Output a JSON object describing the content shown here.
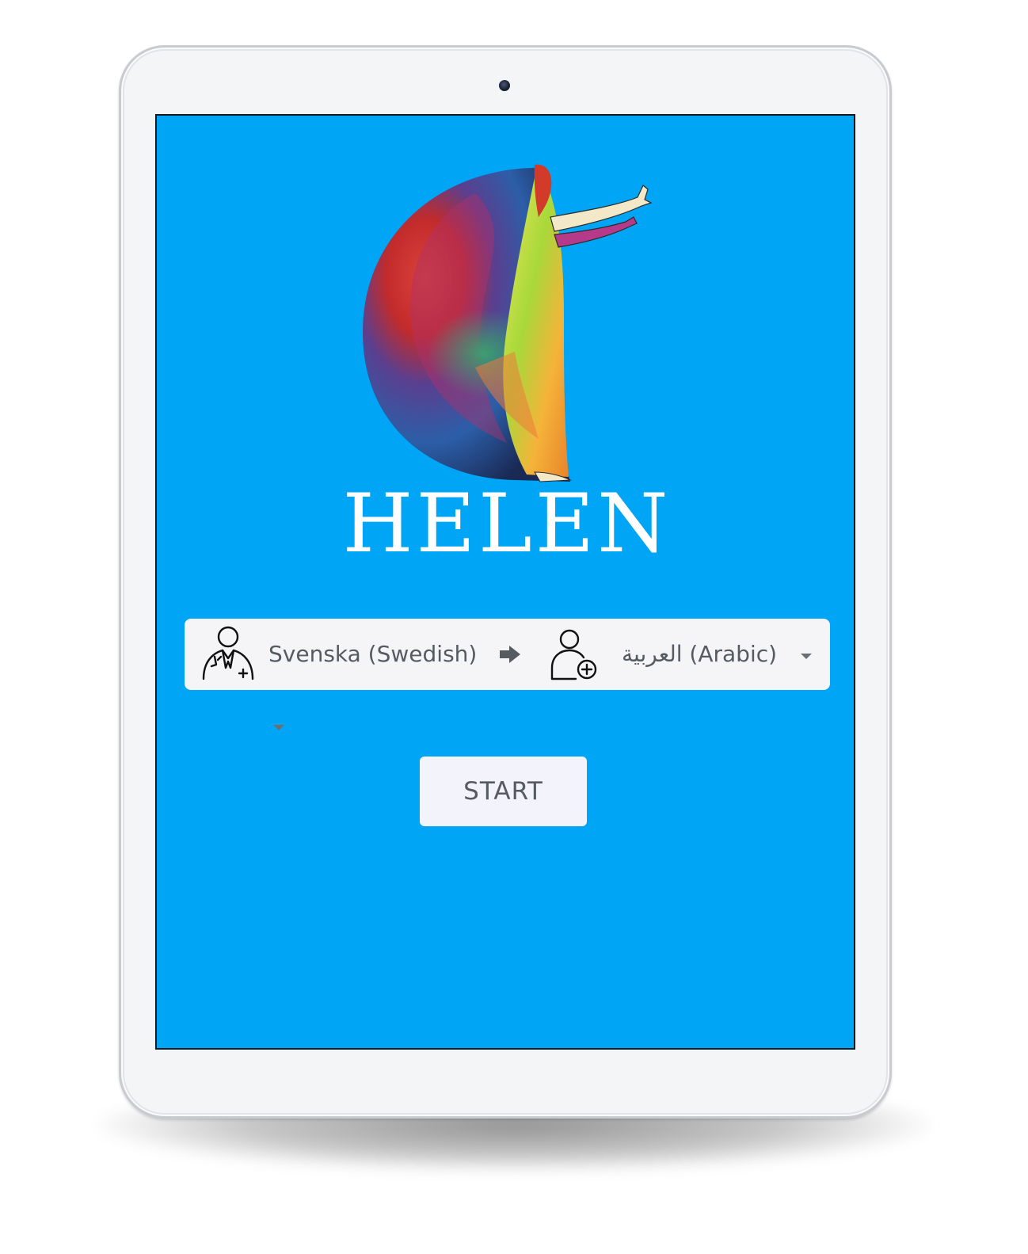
{
  "app": {
    "name": "HELEN",
    "logo_icon": "rainbow-watercolor-woman-icon"
  },
  "colors": {
    "screen_background": "#00a5f5",
    "bar_background": "#f5f5f8",
    "button_background": "#f2f3fb",
    "text": "#555b61"
  },
  "language_bar": {
    "source": {
      "icon": "doctor-icon",
      "label": "Svenska (Swedish)"
    },
    "direction_icon": "arrow-right-icon",
    "target": {
      "icon": "patient-add-icon",
      "label": "العربية (Arabic)"
    }
  },
  "actions": {
    "start_label": "START"
  }
}
